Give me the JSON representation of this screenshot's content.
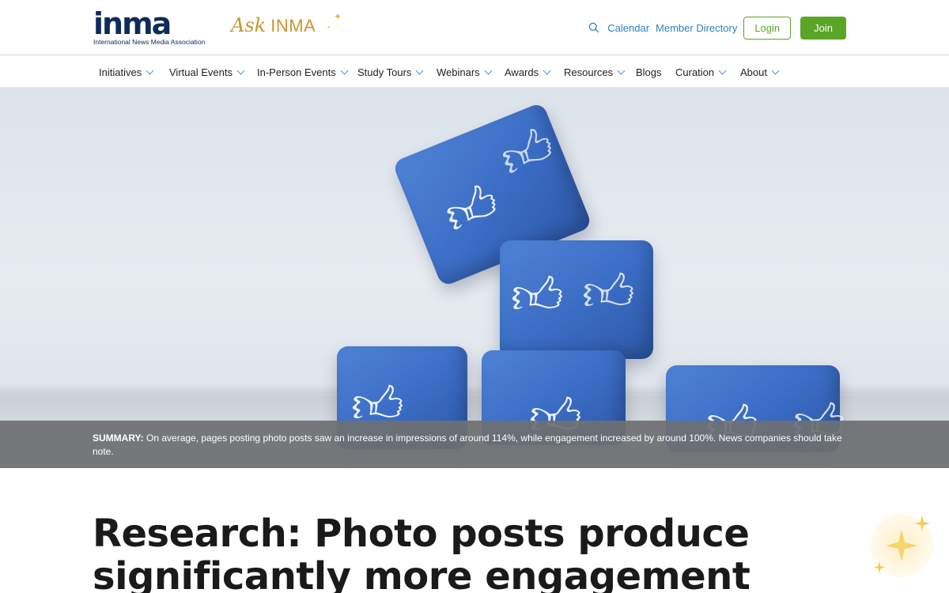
{
  "header": {
    "logo_word": "inma",
    "logo_tagline": "International News Media Association",
    "ask": {
      "word": "Ask",
      "brand": "INMA"
    },
    "links": {
      "calendar": "Calendar",
      "member_directory": "Member Directory"
    },
    "buttons": {
      "login": "Login",
      "join": "Join"
    }
  },
  "nav": {
    "items": [
      {
        "label": "Initiatives",
        "dropdown": true
      },
      {
        "label": "Virtual Events",
        "dropdown": true
      },
      {
        "label": "In-Person Events",
        "dropdown": true
      },
      {
        "label": "Study Tours",
        "dropdown": true
      },
      {
        "label": "Webinars",
        "dropdown": true
      },
      {
        "label": "Awards",
        "dropdown": true
      },
      {
        "label": "Resources",
        "dropdown": true
      },
      {
        "label": "Blogs",
        "dropdown": false
      },
      {
        "label": "Curation",
        "dropdown": true
      },
      {
        "label": "About",
        "dropdown": true
      }
    ]
  },
  "hero": {
    "image_icon": "thumbs-up-icon",
    "summary_label": "SUMMARY:",
    "summary_text": " On average, pages posting photo posts saw an increase in impressions of around 114%, while engagement increased by around 100%. News companies should take note."
  },
  "article": {
    "title_line1": "Research: Photo posts produce",
    "title_line2": "significantly more engagement"
  },
  "colors": {
    "brand_navy": "#0d2b5c",
    "ask_gold": "#c8972f",
    "link_blue": "#2f7fc1",
    "join_green": "#5aa526",
    "cube_blue": "#3a6cc4"
  }
}
